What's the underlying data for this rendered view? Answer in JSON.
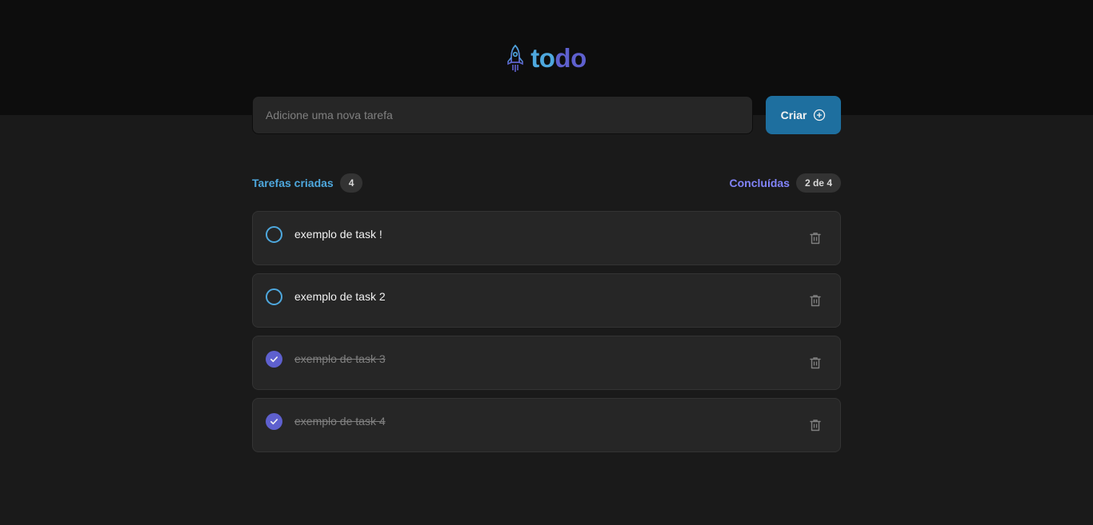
{
  "app": {
    "logo_part1": "to",
    "logo_part2": "do",
    "logo_icon": "rocket-icon",
    "colors": {
      "blue": "#4ea8de",
      "purple": "#5e60ce",
      "purple_light": "#8284fa",
      "button": "#1e6f9f",
      "background": "#1a1a1a",
      "header": "#0d0d0d",
      "card": "#262626"
    }
  },
  "new_task": {
    "placeholder": "Adicione uma nova tarefa",
    "value": ""
  },
  "create_button": {
    "label": "Criar",
    "icon": "plus-circle-icon"
  },
  "counters": {
    "created_label": "Tarefas criadas",
    "created_count": "4",
    "done_label": "Concluídas",
    "done_count": "2 de 4"
  },
  "tasks": [
    {
      "text": "exemplo de task !",
      "completed": false
    },
    {
      "text": "exemplo de task 2",
      "completed": false
    },
    {
      "text": "exemplo de task 3",
      "completed": true
    },
    {
      "text": "exemplo de task 4",
      "completed": true
    }
  ]
}
